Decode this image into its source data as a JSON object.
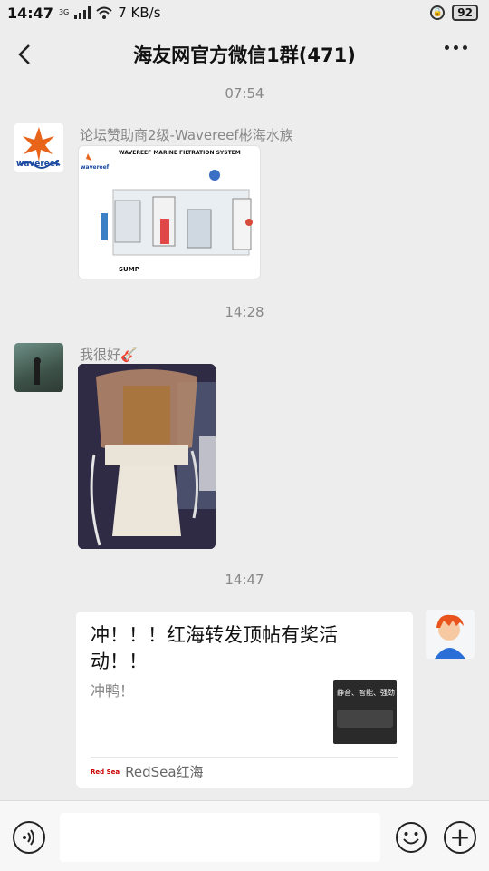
{
  "status_bar": {
    "time": "14:47",
    "network": "3G",
    "speed": "7 KB/s",
    "battery": "92"
  },
  "header": {
    "title": "海友网官方微信1群(471)",
    "back_icon": "chevron-left-icon",
    "more_icon": "more-dots-icon"
  },
  "messages": [
    {
      "type": "timestamp",
      "text": "07:54"
    },
    {
      "type": "image",
      "sender": "论坛赞助商2级-Wavereef彬海水族",
      "avatar_text": "wavereef",
      "image_title": "WAVEREEF MARINE FILTRATION SYSTEM",
      "image_label": "SUMP",
      "image_logo": "wavereef"
    },
    {
      "type": "timestamp",
      "text": "14:28"
    },
    {
      "type": "image",
      "sender": "我很好🎸",
      "image_desc": "protein skimmer photo"
    },
    {
      "type": "timestamp",
      "text": "14:47"
    },
    {
      "type": "card",
      "title": "冲！！！红海转发顶帖有奖活动！！",
      "desc": "冲鸭！",
      "source": "RedSea红海",
      "source_logo": "Red Sea",
      "thumb_text": "静音、智能、强劲"
    }
  ],
  "input_bar": {
    "placeholder": ""
  },
  "colors": {
    "background": "#ededed",
    "bubble": "#ffffff",
    "meta_text": "#888888"
  }
}
